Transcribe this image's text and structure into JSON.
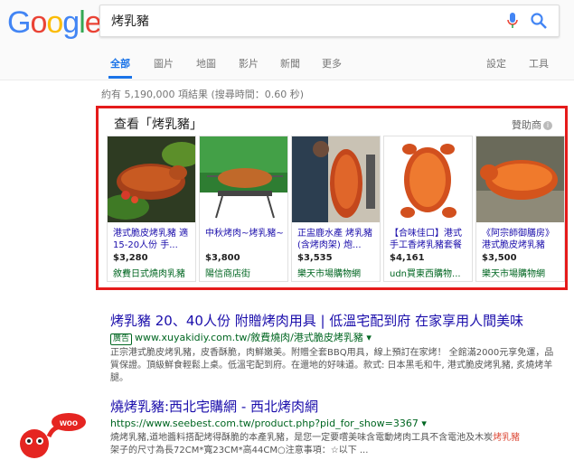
{
  "logo": [
    "G",
    "o",
    "o",
    "g",
    "l",
    "e"
  ],
  "search": {
    "query": "烤乳豬"
  },
  "tabs": [
    "全部",
    "圖片",
    "地圖",
    "影片",
    "新聞",
    "更多",
    "設定",
    "工具"
  ],
  "stats": "約有 5,190,000 項結果 (搜尋時間：0.60 秒)",
  "shopping": {
    "title": "查看「烤乳豬」",
    "sponsor": "贊助商",
    "info_icon": "i",
    "products": [
      {
        "title": "港式脆皮烤乳豬 適15-20人份 手...",
        "price": "$3,280",
        "store": "敘費日式燒肉乳豬"
      },
      {
        "title": "中秋烤肉~烤乳豬~",
        "price": "$3,800",
        "store": "陽信商店街"
      },
      {
        "title": "正盅鹿水產 烤乳豬(含烤肉架) 炮...",
        "price": "$3,535",
        "store": "樂天市場購物網"
      },
      {
        "title": "【合味佳口】港式手工香烤乳豬套餐",
        "price": "$4,161",
        "store": "udn買東西購物..."
      },
      {
        "title": "《阿宗師御膳房》港式脆皮烤乳豬",
        "price": "$3,500",
        "store": "樂天市場購物網"
      }
    ]
  },
  "results": [
    {
      "title": "烤乳豬 20、40人份 附贈烤肉用具 | 低溫宅配到府 在家享用人間美味",
      "ad": "廣告",
      "url": "www.xuyakidiy.com.tw/敘費燒肉/港式脆皮烤乳豬",
      "snippet": "正宗港式脆皮烤乳豬，皮香酥脆，肉鮮嫩美。附贈全套BBQ用具，線上預訂在家烤！ 全館滿2000元享免運，品質保證。頂級鮮食輕鬆上桌。低溫宅配到府。在還地的好味道。款式: 日本黑毛和牛, 港式脆皮烤乳豬, 炙燒烤羊腿。"
    },
    {
      "title": "燒烤乳豬:西北宅購網 - 西北烤肉網",
      "url": "https://www.seebest.com.tw/product.php?pid_for_show=3367",
      "snippet_pre": "燒烤乳豬,道地醬料搭配烤得酥脆的本產乳豬，是您一定要嚐美味含電動烤肉工具不含電池及木炭",
      "snippet_hl": "烤乳豬",
      "snippet_post": "架子的尺寸為長72CM*寬23CM*高44CM○注意事項：☆以下 ..."
    }
  ],
  "watermark": {
    "text": "woo"
  },
  "colors": {
    "accent": "#1a73e8",
    "link": "#1a0dab",
    "url": "#006621",
    "highlight_box": "#e51b1b"
  }
}
